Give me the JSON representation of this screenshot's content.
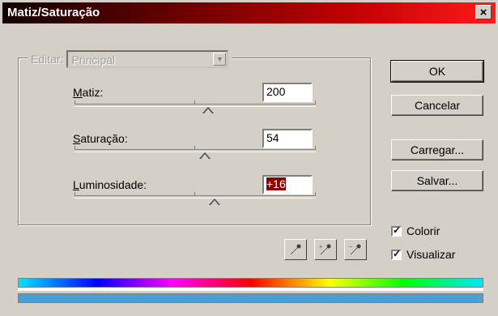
{
  "window": {
    "title": "Matiz/Saturação",
    "close_label": "×"
  },
  "edit": {
    "label": "Editar:",
    "value": "Principal"
  },
  "rows": [
    {
      "label_first": "M",
      "label_rest": "atiz:",
      "value": "200",
      "thumb_fraction": 0.555
    },
    {
      "label_first": "S",
      "label_rest": "aturação:",
      "value": "54",
      "thumb_fraction": 0.54
    },
    {
      "label_first": "L",
      "label_rest": "uminosidade:",
      "value": "+16",
      "thumb_fraction": 0.58
    }
  ],
  "buttons": {
    "ok": "OK",
    "cancel": "Cancelar",
    "load": "Carregar...",
    "save": "Salvar..."
  },
  "checkboxes": {
    "colorize": {
      "label": "Colorir",
      "checked": true
    },
    "preview": {
      "label": "Visualizar",
      "checked": true
    }
  },
  "icons": [
    "eyedropper-icon",
    "eyedropper-plus-icon",
    "eyedropper-minus-icon"
  ],
  "colors": {
    "title_start": "#120000",
    "title_end": "#ff1a1a",
    "selection": "#8b0000",
    "bottom_bar": "#4aa0d6"
  }
}
